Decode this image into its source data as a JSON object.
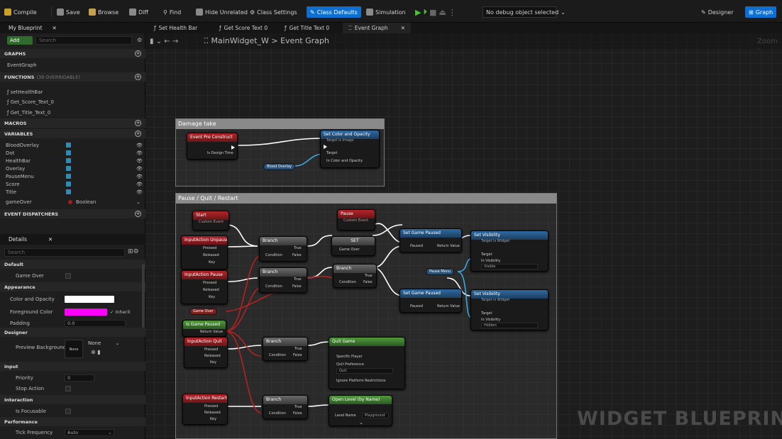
{
  "toolbar": {
    "compile": "Compile",
    "save": "Save",
    "browse": "Browse",
    "diff": "Diff",
    "find": "Find",
    "hide": "Hide Unrelated",
    "class_settings": "Class Settings",
    "class_defaults": "Class Defaults",
    "simulation": "Simulation",
    "debug": "No debug object selected",
    "designer": "Designer",
    "graph": "Graph"
  },
  "my_blueprint": {
    "tab": "My Blueprint",
    "add": "Add",
    "search": "Search",
    "graphs_header": "GRAPHS",
    "event_graph": "EventGraph",
    "functions_header": "FUNCTIONS",
    "functions_overridable": "(38 OVERRIDABLE)",
    "functions": [
      "setHealthBar",
      "Get_Score_Text_0",
      "Get_Title_Text_0"
    ],
    "macros": "MACROS",
    "variables_header": "VARIABLES",
    "variables": [
      "BloodOverlay",
      "Dot",
      "HealthBar",
      "Overlay",
      "PauseMenu",
      "Score",
      "Title",
      "gameOver"
    ],
    "gameover_type": "Boolean",
    "event_dispatchers": "EVENT DISPATCHERS"
  },
  "details": {
    "tab": "Details",
    "search": "Search",
    "default": "Default",
    "game_over": "Game Over",
    "appearance": "Appearance",
    "color_opacity": "Color and Opacity",
    "foreground": "Foreground Color",
    "inherit": "Inherit",
    "padding": "Padding",
    "padding_val": "0.0",
    "designer": "Designer",
    "preview_bg": "Preview Background",
    "none": "None",
    "input": "Input",
    "priority": "Priority",
    "priority_val": "0",
    "stop_action": "Stop Action",
    "interaction": "Interaction",
    "is_focusable": "Is Focusable",
    "performance": "Performance",
    "tick_freq": "Tick Frequency",
    "auto": "Auto"
  },
  "tabs": [
    "Set Health Bar",
    "Get Score Text 0",
    "Get Title Text 0",
    "Event Graph"
  ],
  "breadcrumb": {
    "widget": "MainWidget_W",
    "graph": "Event Graph"
  },
  "zoom": "Zoom -",
  "comments": {
    "damage": "Damage take",
    "pause": "Pause / Quit / Restart"
  },
  "nodes": {
    "pre_construct": "Event Pre Construct",
    "is_design_time": "Is Design Time",
    "set_color": "Set Color and Opacity",
    "set_color_sub": "Target is Image",
    "target": "Target",
    "in_color": "In Color and Opacity",
    "blood_overlay": "Blood Overlay",
    "start": "Start",
    "custom_event": "Custom Event",
    "pause": "Pause",
    "ia_unpause": "InputAction Unpause",
    "ia_pause": "InputAction Pause",
    "ia_quit": "InputAction Quit",
    "ia_restart": "InputAction Restart",
    "pressed": "Pressed",
    "released": "Released",
    "key": "Key",
    "branch": "Branch",
    "condition": "Condition",
    "true": "True",
    "false": "False",
    "set": "SET",
    "game_over": "Game Over",
    "is_game_paused": "Is Game Paused",
    "return_value": "Return Value",
    "set_game_paused": "Set Game Paused",
    "paused": "Paused",
    "set_visibility": "Set Visibility",
    "set_vis_sub": "Target is Widget",
    "in_visibility": "In Visibility",
    "visible": "Visible",
    "hidden": "Hidden",
    "pause_menu": "Pause Menu",
    "quit_game": "Quit Game",
    "specific_player": "Specific Player",
    "quit_preference": "Quit Preference",
    "quit": "Quit",
    "ignore_platform": "Ignore Platform Restrictions",
    "open_level": "Open Level (by Name)",
    "level_name": "Level Name",
    "level_val": "Playground"
  },
  "watermark": "WIDGET BLUEPRINT",
  "colors": {
    "accent": "#0e6fd0",
    "color_opacity_swatch": "#ffffff",
    "foreground_swatch": "#ff00ff"
  }
}
